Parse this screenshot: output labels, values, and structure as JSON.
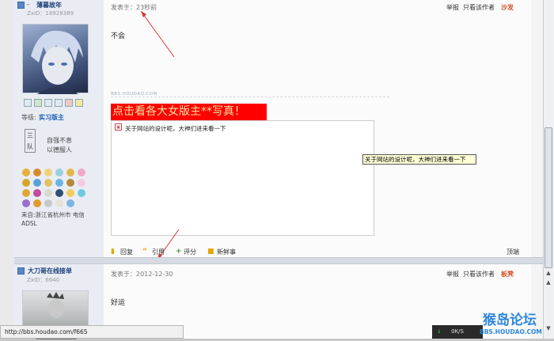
{
  "post1": {
    "username": "薄暮故年",
    "uid": "ZxID：18928389",
    "level_label": "等级:",
    "level": "实习版主",
    "bio_line1": "自强不息",
    "bio_line2": "以德服人",
    "bio_tag_top": "三",
    "bio_tag_bottom": "队",
    "location": "来自:浙江省杭州市 电信ADSL",
    "posted": "发表于：23秒前",
    "report": "举报",
    "only_author": "只看该作者",
    "floor": "沙发",
    "body": "不会",
    "watermark": "BBS.HOUDAO.COM",
    "ad_text": "点击看各大女版主**写真！",
    "broken_img_text": "关于网站的设计呢，大神们进来看一下",
    "tooltip": "关于网站的设计呢，大神们进来看一下",
    "reply": "回复",
    "quote": "引用",
    "rate": "评分",
    "fresh": "新鲜事",
    "top": "顶端"
  },
  "post2": {
    "username": "大刀哥在线接单",
    "uid": "ZxID：6640",
    "posted": "发表于：2012-12-30",
    "report": "举报",
    "only_author": "只看该作者",
    "floor": "板凳",
    "body": "好运"
  },
  "statusbar": {
    "url": "http://bbs.houdao.com/f665",
    "speed": "0K/S"
  },
  "brand": {
    "logo_text": "猴岛论坛",
    "logo_url": "BBS.HOUDAO.COM"
  },
  "colors": {
    "accent": "#d2532b",
    "ad_bg": "#ff0000",
    "name": "#1a3f7a"
  }
}
